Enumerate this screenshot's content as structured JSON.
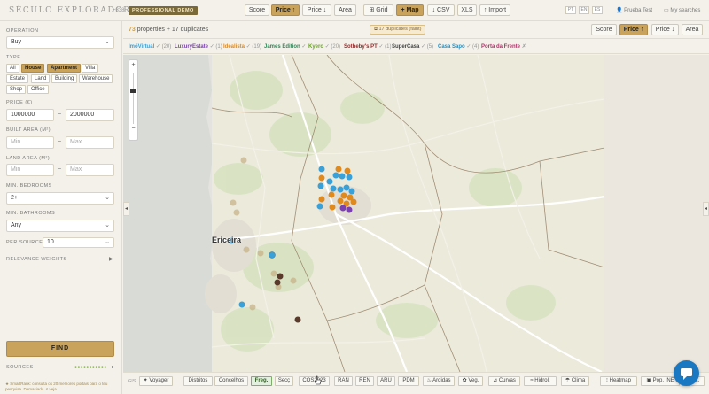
{
  "topbar": {
    "brand": "SÉCULO EXPLORADOR",
    "count": "+338",
    "demo": "PROFESSIONAL DEMO",
    "sort_score": "Score",
    "sort_price_up": "Price ↑",
    "sort_price_down": "Price ↓",
    "sort_area": "Area",
    "grid": "⊞ Grid",
    "map": "+ Map",
    "csv": "↓ CSV",
    "xls": "XLS",
    "import": "↑ Import",
    "langs": [
      "PT",
      "EN",
      "ES"
    ],
    "user": "Prueba Test",
    "searches": "My searches"
  },
  "sidebar": {
    "operation_label": "OPERATION",
    "operation_value": "Buy",
    "type_label": "TYPE",
    "types": [
      {
        "label": "All",
        "on": false
      },
      {
        "label": "House",
        "on": true
      },
      {
        "label": "Apartment",
        "on": true
      },
      {
        "label": "Villa",
        "on": false
      },
      {
        "label": "Estate",
        "on": false
      },
      {
        "label": "Land",
        "on": false
      },
      {
        "label": "Building",
        "on": false
      },
      {
        "label": "Warehouse",
        "on": false
      },
      {
        "label": "Shop",
        "on": false
      },
      {
        "label": "Office",
        "on": false
      }
    ],
    "price_label": "PRICE (€)",
    "price_min": "1000000",
    "price_max": "2000000",
    "built_label": "BUILT AREA (M²)",
    "built_min_ph": "Min",
    "built_max_ph": "Max",
    "land_label": "LAND AREA (M²)",
    "land_min_ph": "Min",
    "land_max_ph": "Max",
    "bedrooms_label": "MIN. BEDROOMS",
    "bedrooms_value": "2+",
    "bathrooms_label": "MIN. BATHROOMS",
    "bathrooms_value": "Any",
    "per_source_label": "PER SOURCE",
    "per_source_value": "10",
    "relevance_label": "RELEVANCE WEIGHTS",
    "find": "FIND",
    "sources_label": "SOURCES",
    "tip": "★ SmartRank: consulta os 20 melhores portais para o teu pesquisa. Demasiado ↗ veja"
  },
  "results": {
    "count": "73",
    "count_text": " properties + 17 duplicates",
    "dup_badge": "⧉ 17 duplicates (faint)",
    "sort_score": "Score",
    "sort_price_up": "Price ↑",
    "sort_price_down": "Price ↓",
    "sort_area": "Area"
  },
  "sources": [
    {
      "name": "ImóVirtual",
      "count": "✓ (20)",
      "color": "#3aa0d8"
    },
    {
      "name": "LuxuryEstate",
      "count": "✓ (1)",
      "color": "#7b3fb0"
    },
    {
      "name": "Idealista",
      "count": "✓ (19)",
      "color": "#e08a1e"
    },
    {
      "name": "James Edition",
      "count": "✓",
      "color": "#2f8a5a"
    },
    {
      "name": "Kyero",
      "count": "✓ (20)",
      "color": "#6aa02a"
    },
    {
      "name": "Sotheby's PT",
      "count": "✓ (1)",
      "color": "#9a2a2a"
    },
    {
      "name": "SuperCasa",
      "count": "✓ (5)",
      "color": "#444444"
    },
    {
      "name": "Casa Sapo",
      "count": "✓ (4)",
      "color": "#1a90c8"
    },
    {
      "name": "Porta da Frente",
      "count": "✗",
      "color": "#b0306a"
    }
  ],
  "map": {
    "zoom_in": "+",
    "zoom_out": "−",
    "place": "Ericeira"
  },
  "gis": {
    "label": "GIS",
    "buttons": [
      {
        "label": "✦ Voyager",
        "on": false
      },
      {
        "label": "Distritos",
        "on": false
      },
      {
        "label": "Concelhos",
        "on": false
      },
      {
        "label": "Freg.",
        "on": true
      },
      {
        "label": "Secç",
        "on": false
      },
      {
        "label": "COS2023",
        "on": false
      },
      {
        "label": "RAN",
        "on": false
      },
      {
        "label": "REN",
        "on": false
      },
      {
        "label": "ARU",
        "on": false
      },
      {
        "label": "PDM",
        "on": false
      },
      {
        "label": "♨ Ardidas",
        "on": false
      },
      {
        "label": "✿ Veg.",
        "on": false
      },
      {
        "label": "⊿ Curvas",
        "on": false
      },
      {
        "label": "≈ Hidrol.",
        "on": false
      },
      {
        "label": "☂ Clima",
        "on": false
      },
      {
        "label": "⁝ Heatmap",
        "on": false
      },
      {
        "label": "▣ Pop. INE",
        "on": false
      },
      {
        "label": "Cont.",
        "on": false
      }
    ]
  },
  "colors": {
    "accent": "#c9a35c",
    "idealista": "#e08a1e",
    "imovirtual": "#3aa0d8",
    "luxury": "#7b3fb0",
    "dup": "#c8b48a"
  }
}
